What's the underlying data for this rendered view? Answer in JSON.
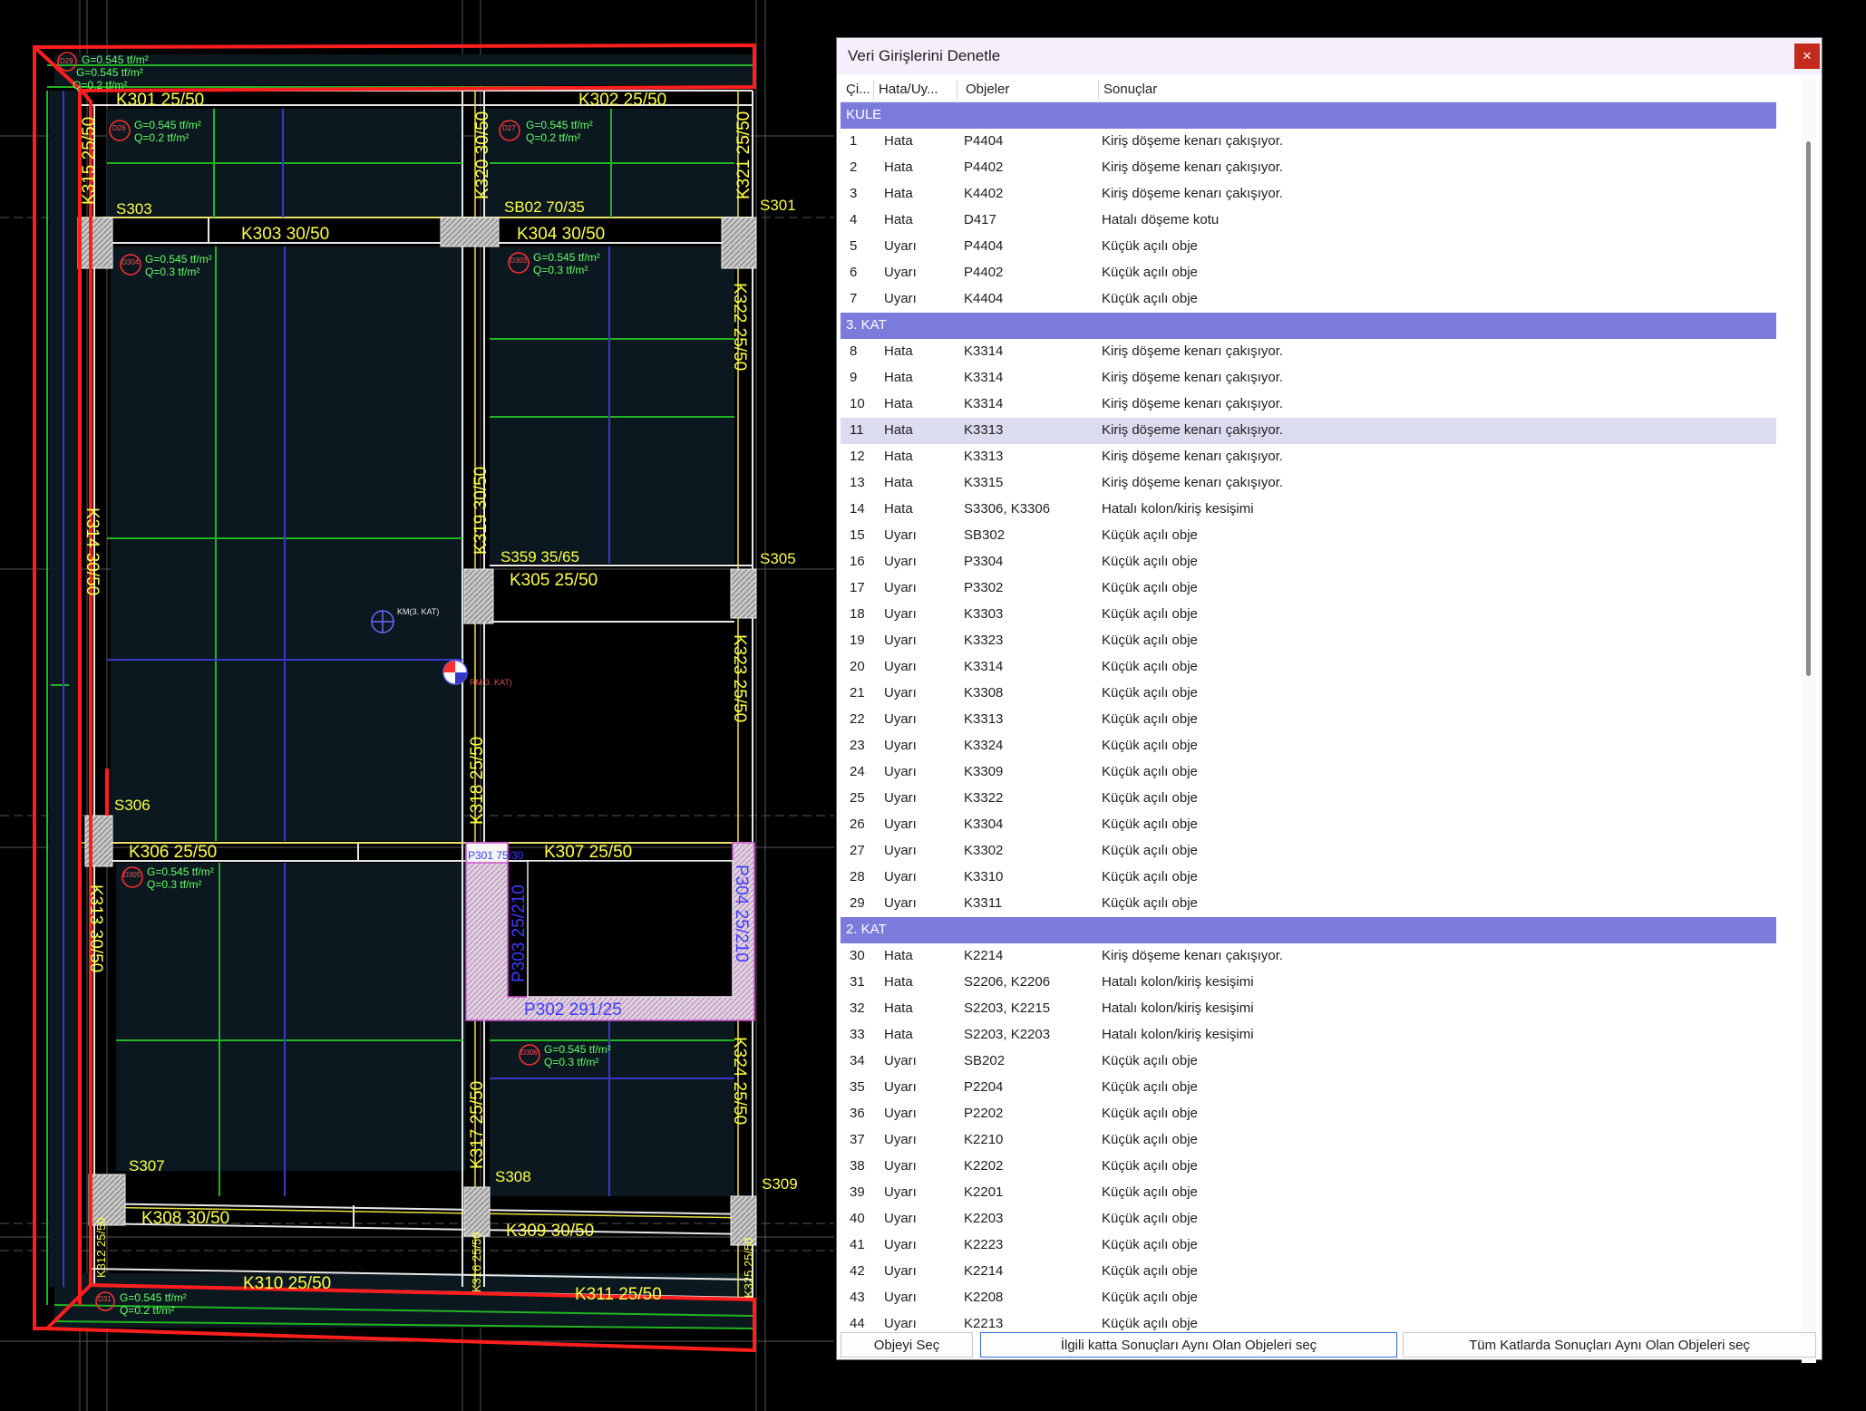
{
  "cad": {
    "beams": [
      "K301   25/50",
      "K302   25/50",
      "K303   30/50",
      "K304   30/50",
      "K305   25/50",
      "K306   25/50",
      "K307   25/50",
      "K308   30/50",
      "K309   30/50",
      "K310   25/50",
      "K311   25/50"
    ],
    "vbeams": [
      "K315  25/50",
      "K320  30/50",
      "K321  25/50",
      "K322   25/50",
      "K319   30/50",
      "K314   30/50",
      "K323   25/50",
      "K318   25/50",
      "K313   30/50",
      "K324   25/50",
      "K317   25/50",
      "K312 25/50",
      "K316 25/50",
      "K325 25/50"
    ],
    "columns": [
      "S303",
      "SB02 70/35",
      "S301",
      "S359 35/65",
      "S305",
      "S306",
      "S307",
      "S308",
      "S309"
    ],
    "panels": [
      "P301 75/30",
      "P303  25/210",
      "P304   25/210",
      "P302   291/25"
    ],
    "slab_ids": [
      "D26",
      "D27",
      "D304",
      "D303",
      "D305",
      "D306",
      "D31",
      "D29"
    ],
    "slab_loads": {
      "g": "G=0.545 tf/m²",
      "q_low": "Q=0.2 tf/m²",
      "q_mid": "Q=0.3 tf/m²"
    },
    "markers": [
      "KM(3. KAT)",
      "RM(3. KAT)"
    ],
    "colors": {
      "background": "#000000",
      "slab_fill": "#0b1820",
      "beam_label": "#ffff44",
      "red_outline": "#ff1e1e",
      "green_line": "#22b422",
      "blue_line": "#3838c8",
      "panel_label": "#3c3cff",
      "load_text": "#66ff66"
    }
  },
  "dialog": {
    "title": "Veri Girişlerini Denetle",
    "close_icon": "close-icon",
    "columns": [
      "Çi...",
      "Hata/Uy...",
      "Objeler",
      "Sonuçlar"
    ],
    "rows": [
      {
        "group": "KULE"
      },
      {
        "n": "1",
        "t": "Hata",
        "o": "P4404",
        "r": "Kiriş döşeme kenarı çakışıyor."
      },
      {
        "n": "2",
        "t": "Hata",
        "o": "P4402",
        "r": "Kiriş döşeme kenarı çakışıyor."
      },
      {
        "n": "3",
        "t": "Hata",
        "o": "K4402",
        "r": "Kiriş döşeme kenarı çakışıyor."
      },
      {
        "n": "4",
        "t": "Hata",
        "o": "D417",
        "r": "Hatalı döşeme kotu"
      },
      {
        "n": "5",
        "t": "Uyarı",
        "o": "P4404",
        "r": "Küçük açılı obje"
      },
      {
        "n": "6",
        "t": "Uyarı",
        "o": "P4402",
        "r": "Küçük açılı obje"
      },
      {
        "n": "7",
        "t": "Uyarı",
        "o": "K4404",
        "r": "Küçük açılı obje"
      },
      {
        "group": "3. KAT"
      },
      {
        "n": "8",
        "t": "Hata",
        "o": "K3314",
        "r": "Kiriş döşeme kenarı çakışıyor."
      },
      {
        "n": "9",
        "t": "Hata",
        "o": "K3314",
        "r": "Kiriş döşeme kenarı çakışıyor."
      },
      {
        "n": "10",
        "t": "Hata",
        "o": "K3314",
        "r": "Kiriş döşeme kenarı çakışıyor."
      },
      {
        "n": "11",
        "t": "Hata",
        "o": "K3313",
        "r": "Kiriş döşeme kenarı çakışıyor.",
        "selected": true
      },
      {
        "n": "12",
        "t": "Hata",
        "o": "K3313",
        "r": "Kiriş döşeme kenarı çakışıyor."
      },
      {
        "n": "13",
        "t": "Hata",
        "o": "K3315",
        "r": "Kiriş döşeme kenarı çakışıyor."
      },
      {
        "n": "14",
        "t": "Hata",
        "o": "S3306, K3306",
        "r": "Hatalı kolon/kiriş kesişimi"
      },
      {
        "n": "15",
        "t": "Uyarı",
        "o": "SB302",
        "r": "Küçük açılı obje"
      },
      {
        "n": "16",
        "t": "Uyarı",
        "o": "P3304",
        "r": "Küçük açılı obje"
      },
      {
        "n": "17",
        "t": "Uyarı",
        "o": "P3302",
        "r": "Küçük açılı obje"
      },
      {
        "n": "18",
        "t": "Uyarı",
        "o": "K3303",
        "r": "Küçük açılı obje"
      },
      {
        "n": "19",
        "t": "Uyarı",
        "o": "K3323",
        "r": "Küçük açılı obje"
      },
      {
        "n": "20",
        "t": "Uyarı",
        "o": "K3314",
        "r": "Küçük açılı obje"
      },
      {
        "n": "21",
        "t": "Uyarı",
        "o": "K3308",
        "r": "Küçük açılı obje"
      },
      {
        "n": "22",
        "t": "Uyarı",
        "o": "K3313",
        "r": "Küçük açılı obje"
      },
      {
        "n": "23",
        "t": "Uyarı",
        "o": "K3324",
        "r": "Küçük açılı obje"
      },
      {
        "n": "24",
        "t": "Uyarı",
        "o": "K3309",
        "r": "Küçük açılı obje"
      },
      {
        "n": "25",
        "t": "Uyarı",
        "o": "K3322",
        "r": "Küçük açılı obje"
      },
      {
        "n": "26",
        "t": "Uyarı",
        "o": "K3304",
        "r": "Küçük açılı obje"
      },
      {
        "n": "27",
        "t": "Uyarı",
        "o": "K3302",
        "r": "Küçük açılı obje"
      },
      {
        "n": "28",
        "t": "Uyarı",
        "o": "K3310",
        "r": "Küçük açılı obje"
      },
      {
        "n": "29",
        "t": "Uyarı",
        "o": "K3311",
        "r": "Küçük açılı obje"
      },
      {
        "group": "2. KAT"
      },
      {
        "n": "30",
        "t": "Hata",
        "o": "K2214",
        "r": "Kiriş döşeme kenarı çakışıyor."
      },
      {
        "n": "31",
        "t": "Hata",
        "o": "S2206, K2206",
        "r": "Hatalı kolon/kiriş kesişimi"
      },
      {
        "n": "32",
        "t": "Hata",
        "o": "S2203, K2215",
        "r": "Hatalı kolon/kiriş kesişimi"
      },
      {
        "n": "33",
        "t": "Hata",
        "o": "S2203, K2203",
        "r": "Hatalı kolon/kiriş kesişimi"
      },
      {
        "n": "34",
        "t": "Uyarı",
        "o": "SB202",
        "r": "Küçük açılı obje"
      },
      {
        "n": "35",
        "t": "Uyarı",
        "o": "P2204",
        "r": "Küçük açılı obje"
      },
      {
        "n": "36",
        "t": "Uyarı",
        "o": "P2202",
        "r": "Küçük açılı obje"
      },
      {
        "n": "37",
        "t": "Uyarı",
        "o": "K2210",
        "r": "Küçük açılı obje"
      },
      {
        "n": "38",
        "t": "Uyarı",
        "o": "K2202",
        "r": "Küçük açılı obje"
      },
      {
        "n": "39",
        "t": "Uyarı",
        "o": "K2201",
        "r": "Küçük açılı obje"
      },
      {
        "n": "40",
        "t": "Uyarı",
        "o": "K2203",
        "r": "Küçük açılı obje"
      },
      {
        "n": "41",
        "t": "Uyarı",
        "o": "K2223",
        "r": "Küçük açılı obje"
      },
      {
        "n": "42",
        "t": "Uyarı",
        "o": "K2214",
        "r": "Küçük açılı obje"
      },
      {
        "n": "43",
        "t": "Uyarı",
        "o": "K2208",
        "r": "Küçük açılı obje"
      },
      {
        "n": "44",
        "t": "Uyarı",
        "o": "K2213",
        "r": "Küçük açılı obje"
      }
    ],
    "buttons": {
      "select": "Objeyi Seç",
      "same_floor": "İlgili katta Sonuçları Aynı Olan Objeleri seç",
      "all_floors": "Tüm Katlarda Sonuçları Aynı Olan Objeleri seç"
    },
    "colors": {
      "group_bg": "#7b7bdc",
      "selected_bg": "#dcdcf0",
      "close_bg": "#c42b1c",
      "title_bg": "#f4effa"
    }
  }
}
